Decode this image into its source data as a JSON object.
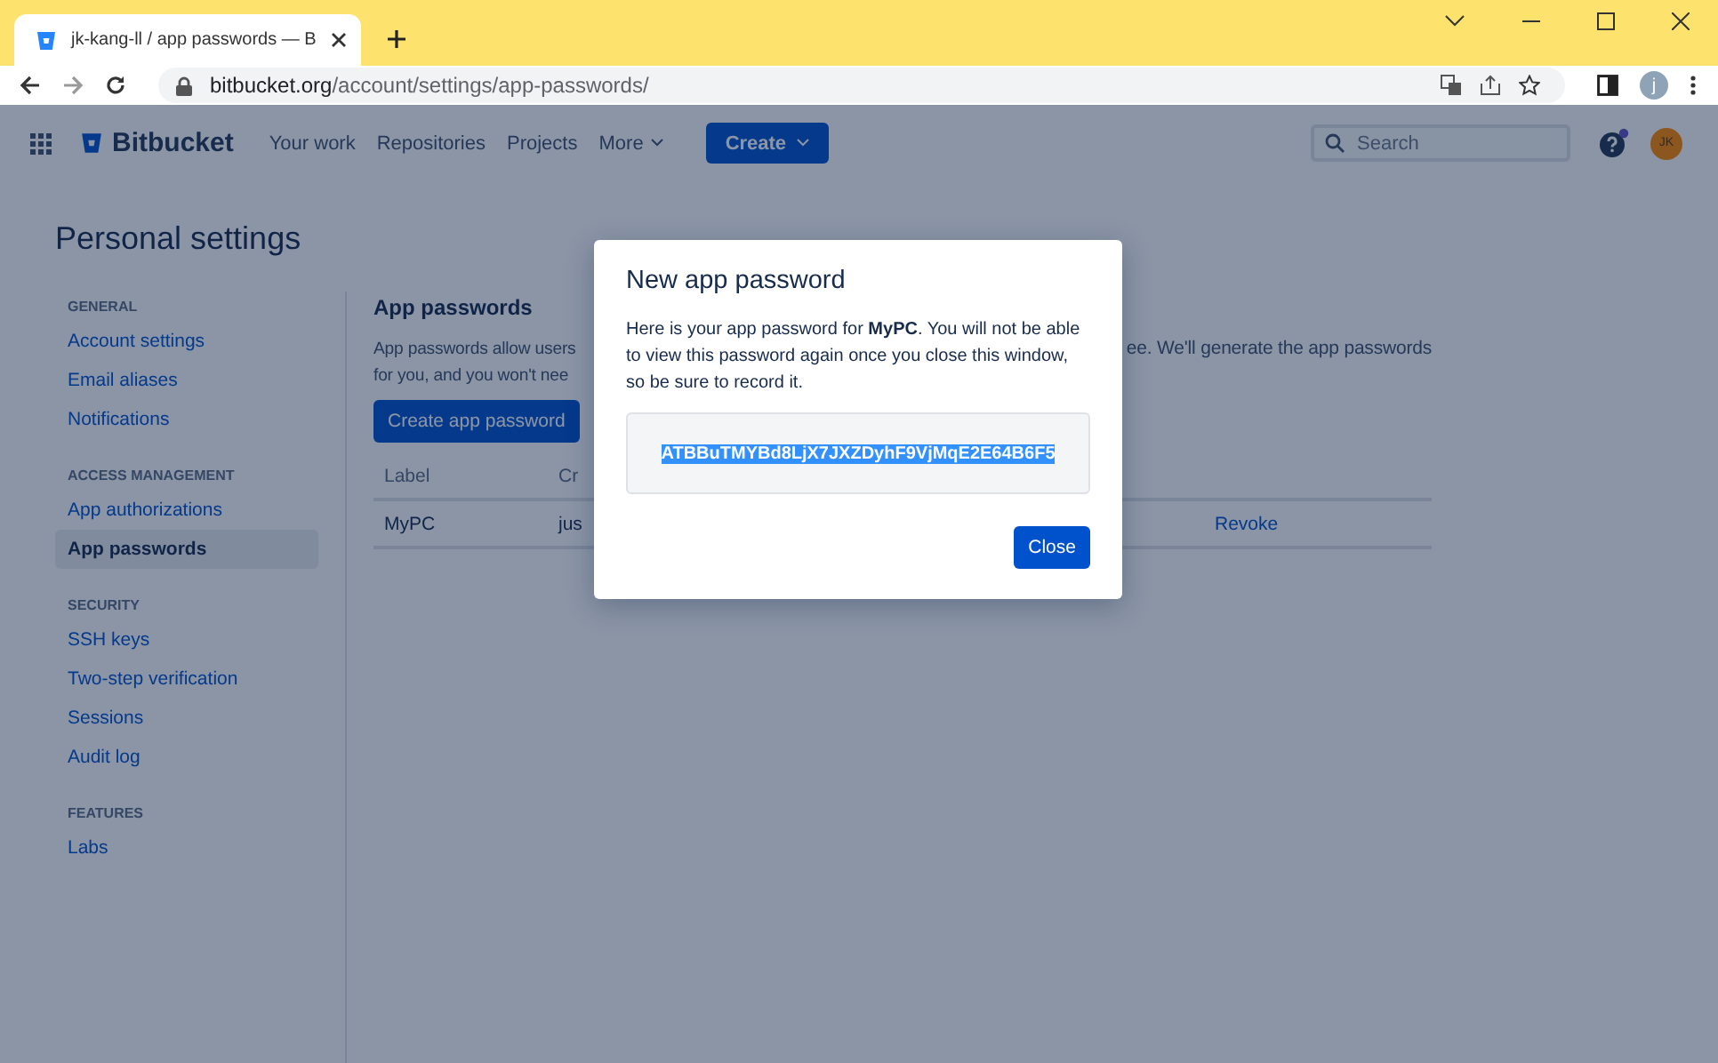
{
  "browser": {
    "tab_title": "jk-kang-ll / app passwords — B",
    "url_host": "bitbucket.org",
    "url_path": "/account/settings/app-passwords/",
    "profile_initial": "j"
  },
  "nav": {
    "product": "Bitbucket",
    "items": [
      "Your work",
      "Repositories",
      "Projects",
      "More"
    ],
    "create": "Create",
    "search": {
      "placeholder": "Search"
    },
    "avatar": "JK"
  },
  "page_title": "Personal settings",
  "sidebar": [
    {
      "heading": "GENERAL",
      "items": [
        {
          "label": "Account settings",
          "selected": false
        },
        {
          "label": "Email aliases",
          "selected": false
        },
        {
          "label": "Notifications",
          "selected": false
        }
      ]
    },
    {
      "heading": "ACCESS MANAGEMENT",
      "items": [
        {
          "label": "App authorizations",
          "selected": false
        },
        {
          "label": "App passwords",
          "selected": true
        }
      ]
    },
    {
      "heading": "SECURITY",
      "items": [
        {
          "label": "SSH keys",
          "selected": false
        },
        {
          "label": "Two-step verification",
          "selected": false
        },
        {
          "label": "Sessions",
          "selected": false
        },
        {
          "label": "Audit log",
          "selected": false
        }
      ]
    },
    {
      "heading": "FEATURES",
      "items": [
        {
          "label": "Labs",
          "selected": false
        }
      ]
    }
  ],
  "content": {
    "title": "App passwords",
    "description_left": [
      "App passwords allow users",
      "for you, and you won't nee"
    ],
    "description_right": "ee. We'll generate the app passwords",
    "create_button": "Create app password",
    "table": {
      "columns": [
        "Label",
        "Cr"
      ],
      "rows": [
        {
          "label": "MyPC",
          "column_2": "jus",
          "action": "Revoke"
        }
      ]
    }
  },
  "dialog": {
    "title": "New app password",
    "message": "Here is your app password for **MyPC**. You will not be able to view this password again once you close this window, so be sure to record it.",
    "password": "ATBBuTMYBd8LjX7JXZDyhF9VjMqE2E64B6F5",
    "close": "Close"
  }
}
